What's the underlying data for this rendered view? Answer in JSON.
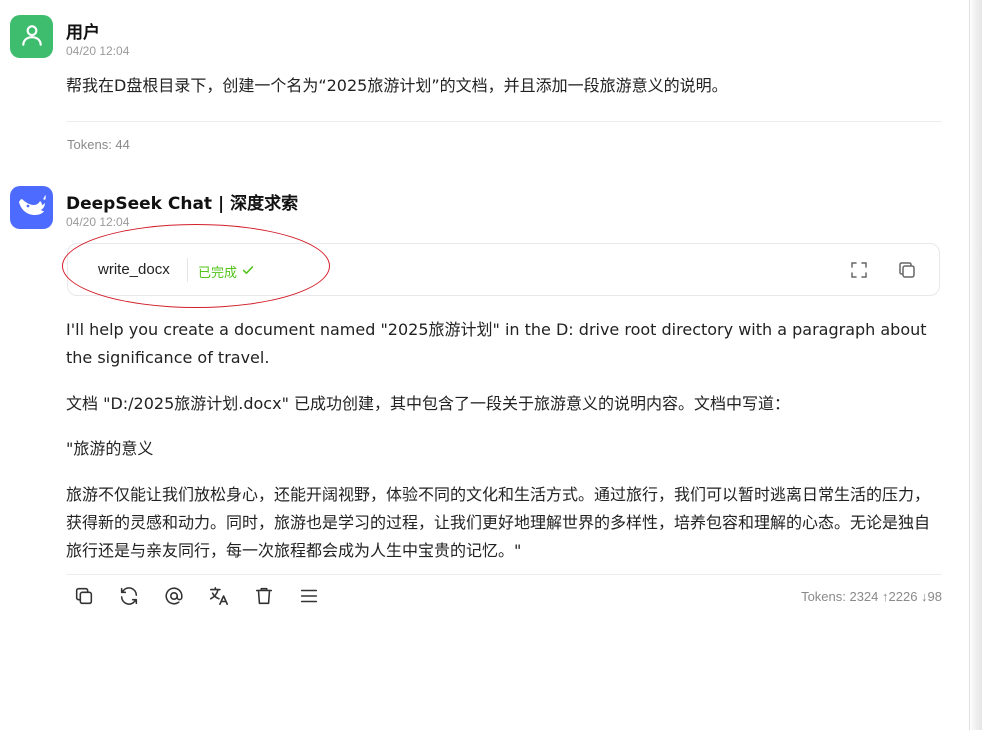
{
  "messages": [
    {
      "role": "user",
      "name": "用户",
      "time": "04/20 12:04",
      "text": "帮我在D盘根目录下，创建一个名为“2025旅游计划”的文档，并且添加一段旅游意义的说明。",
      "tokens": "Tokens: 44",
      "avatar_icon": "user-icon",
      "avatar_color": "#3dbd6d"
    },
    {
      "role": "assistant",
      "name": "DeepSeek Chat | 深度求索",
      "time": "04/20 12:04",
      "avatar_icon": "deepseek-whale-icon",
      "avatar_color": "#4d6bfe",
      "tool_call": {
        "name": "write_docx",
        "status": "已完成",
        "status_color": "#52c41a",
        "actions": [
          "expand-icon",
          "copy-icon"
        ]
      },
      "paragraphs": [
        "I'll help you create a document named \"2025旅游计划\" in the D: drive root directory with a paragraph about the significance of travel.",
        "文档 \"D:/2025旅游计划.docx\" 已成功创建，其中包含了一段关于旅游意义的说明内容。文档中写道：",
        "\"旅游的意义",
        "旅游不仅能让我们放松身心，还能开阔视野，体验不同的文化和生活方式。通过旅行，我们可以暂时逃离日常生活的压力，获得新的灵感和动力。同时，旅游也是学习的过程，让我们更好地理解世界的多样性，培养包容和理解的心态。无论是独自旅行还是与亲友同行，每一次旅程都会成为人生中宝贵的记忆。\""
      ],
      "tokens": "Tokens: 2324 ↑2226 ↓98",
      "action_icons": [
        "copy-icon",
        "regenerate-icon",
        "mention-icon",
        "translate-icon",
        "delete-icon",
        "menu-icon"
      ]
    }
  ],
  "annotation_color": "#d21f2a"
}
